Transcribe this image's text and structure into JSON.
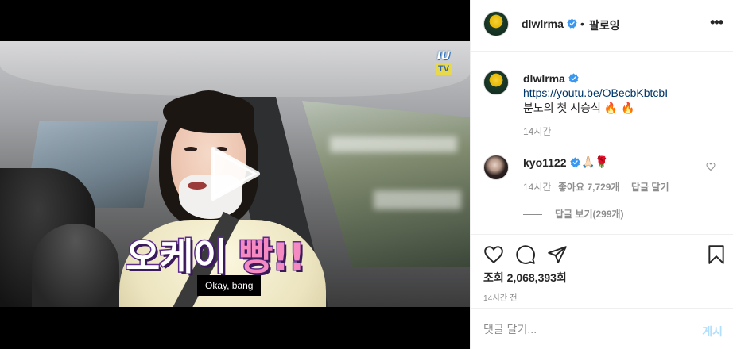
{
  "post": {
    "video": {
      "channel_logo_line1": "IU",
      "channel_logo_line2": "TV",
      "caption_korean_white": "오케이 ",
      "caption_korean_pink": "빵!!",
      "caption_english": "Okay, bang"
    }
  },
  "header": {
    "username": "dlwlrma",
    "separator": "•",
    "follow_status": "팔로잉",
    "more_icon": "•••"
  },
  "caption": {
    "username": "dlwlrma",
    "link": "https://youtu.be/OBecbKbtcbI",
    "text": "분노의 첫 시승식 🔥 🔥",
    "time": "14시간"
  },
  "comment": {
    "username": "kyo1122",
    "text": "🙏🏻🌹",
    "time": "14시간",
    "likes": "좋아요 7,729개",
    "reply_label": "답글 달기",
    "view_replies": "답글 보기(299개)"
  },
  "actions": {
    "views": "조회 2,068,393회",
    "posted": "14시간 전"
  },
  "comment_box": {
    "placeholder": "댓글 달기...",
    "post_label": "게시"
  },
  "colors": {
    "verified_blue": "#3897f0",
    "text_primary": "#262626",
    "text_secondary": "#8e8e8e",
    "post_button_disabled": "#b2dffc"
  }
}
